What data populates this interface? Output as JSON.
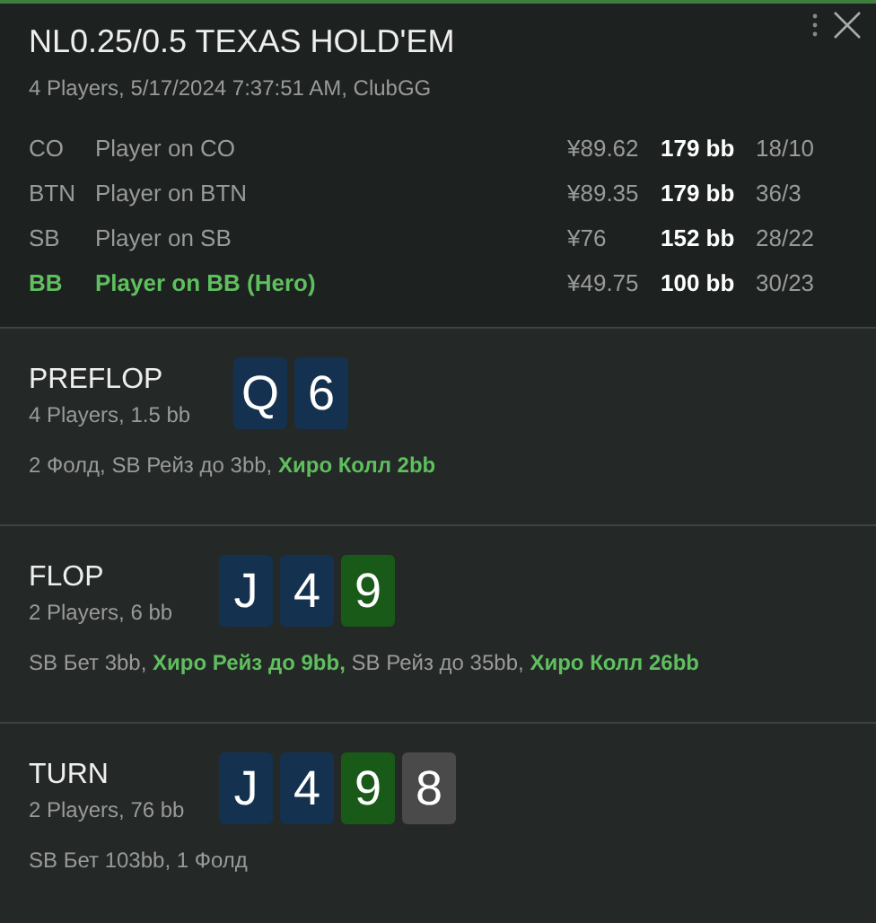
{
  "header": {
    "title": "NL0.25/0.5 TEXAS HOLD'EM",
    "subtitle": "4 Players, 5/17/2024 7:37:51 AM, ClubGG"
  },
  "players": [
    {
      "position": "CO",
      "name": "Player on CO",
      "stack": "¥89.62",
      "bb": "179 bb",
      "stats": "18/10",
      "hero": false
    },
    {
      "position": "BTN",
      "name": "Player on BTN",
      "stack": "¥89.35",
      "bb": "179 bb",
      "stats": "36/3",
      "hero": false
    },
    {
      "position": "SB",
      "name": "Player on SB",
      "stack": "¥76",
      "bb": "152 bb",
      "stats": "28/22",
      "hero": false
    },
    {
      "position": "BB",
      "name": "Player on BB (Hero)",
      "stack": "¥49.75",
      "bb": "100 bb",
      "stats": "30/23",
      "hero": true
    }
  ],
  "streets": [
    {
      "name": "PREFLOP",
      "info": "4 Players, 1.5 bb",
      "cards": [
        {
          "rank": "Q",
          "color": "#14324f"
        },
        {
          "rank": "6",
          "color": "#14324f"
        }
      ],
      "actions": [
        {
          "text": "2 Фолд,",
          "hero": false
        },
        {
          "text": "SB Рейз до 3bb,",
          "hero": false
        },
        {
          "text": "Хиро Колл 2bb",
          "hero": true
        }
      ]
    },
    {
      "name": "FLOP",
      "info": "2 Players, 6 bb",
      "cards": [
        {
          "rank": "J",
          "color": "#14324f"
        },
        {
          "rank": "4",
          "color": "#14324f"
        },
        {
          "rank": "9",
          "color": "#195a19"
        }
      ],
      "actions": [
        {
          "text": "SB Бет 3bb,",
          "hero": false
        },
        {
          "text": "Хиро Рейз до 9bb,",
          "hero": true
        },
        {
          "text": "SB Рейз до 35bb,",
          "hero": false
        },
        {
          "text": "Хиро Колл 26bb",
          "hero": true
        }
      ]
    },
    {
      "name": "TURN",
      "info": "2 Players, 76 bb",
      "cards": [
        {
          "rank": "J",
          "color": "#14324f"
        },
        {
          "rank": "4",
          "color": "#14324f"
        },
        {
          "rank": "9",
          "color": "#195a19"
        },
        {
          "rank": "8",
          "color": "#4a4a4a"
        }
      ],
      "actions": [
        {
          "text": "SB Бет 103bb,",
          "hero": false
        },
        {
          "text": "1 Фолд",
          "hero": false
        }
      ]
    }
  ]
}
